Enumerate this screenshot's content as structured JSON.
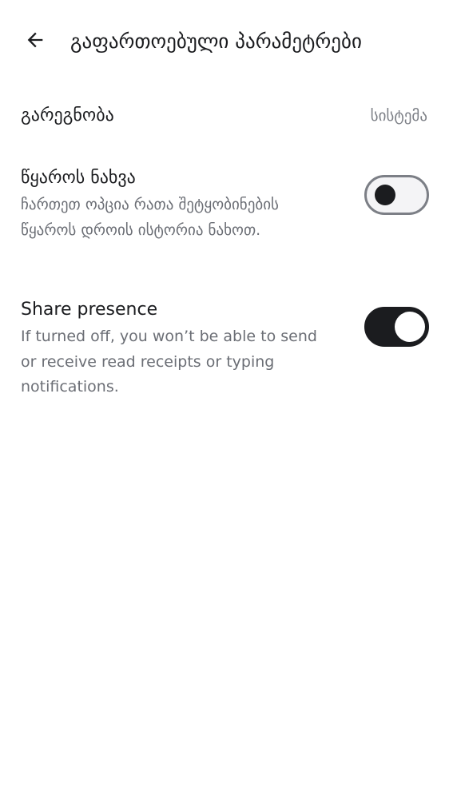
{
  "header": {
    "back_icon": "arrow-left-icon",
    "title": "გაფართოებული პარამეტრები"
  },
  "settings": {
    "appearance": {
      "label": "გარეგნობა",
      "value": "სისტემა"
    },
    "view_source": {
      "label": "წყაროს ნახვა",
      "description": "ჩართეთ ოპცია რათა შეტყობინების წყაროს დროის ისტორია ნახოთ.",
      "enabled": false
    },
    "share_presence": {
      "label": "Share presence",
      "description": "If turned off, you won’t be able to send or receive read receipts or typing notifications.",
      "enabled": true
    }
  },
  "colors": {
    "text_primary": "#1b1c1f",
    "text_secondary": "#6b6e75",
    "toggle_on": "#1b1c1f",
    "toggle_off_track": "#f4f4f6"
  }
}
